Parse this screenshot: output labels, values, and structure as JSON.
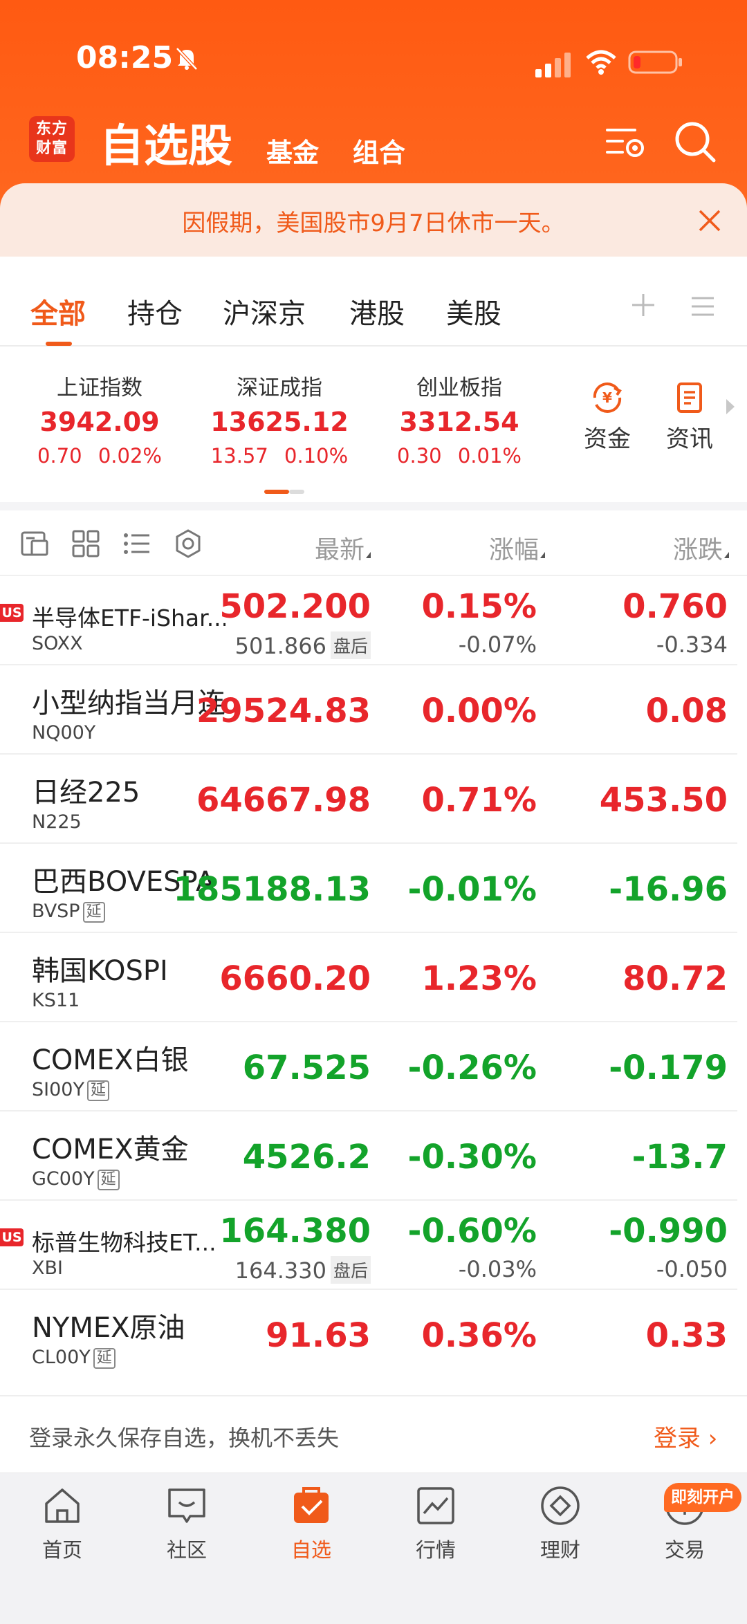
{
  "status_bar": {
    "time": "08:25"
  },
  "header": {
    "logo_line1": "东方",
    "logo_line2": "财富",
    "title": "自选股",
    "tab_fund": "基金",
    "tab_combo": "组合"
  },
  "notice": {
    "text": "因假期，美国股市9月7日休市一天。"
  },
  "tabs": [
    "全部",
    "持仓",
    "沪深京",
    "港股",
    "美股"
  ],
  "indices": [
    {
      "name": "上证指数",
      "value": "3942.09",
      "change": "0.70",
      "pct": "0.02%"
    },
    {
      "name": "深证成指",
      "value": "13625.12",
      "change": "13.57",
      "pct": "0.10%"
    },
    {
      "name": "创业板指",
      "value": "3312.54",
      "change": "0.30",
      "pct": "0.01%"
    }
  ],
  "quick_links": {
    "funds": "资金",
    "news": "资讯"
  },
  "list_header": {
    "latest": "最新",
    "pct": "涨幅",
    "change": "涨跌"
  },
  "rows": [
    {
      "tag": "US",
      "name": "半导体ETF-iShar...",
      "code": "SOXX",
      "price": "502.200",
      "pct": "0.15%",
      "change": "0.760",
      "trend": "up",
      "sub_price": "501.866",
      "sub_tag": "盘后",
      "sub_pct": "-0.07%",
      "sub_change": "-0.334"
    },
    {
      "name": "小型纳指当月连续",
      "code": "NQ00Y",
      "price": "29524.83",
      "pct": "0.00%",
      "change": "0.08",
      "trend": "up"
    },
    {
      "name": "日经225",
      "code": "N225",
      "price": "64667.98",
      "pct": "0.71%",
      "change": "453.50",
      "trend": "up"
    },
    {
      "name": "巴西BOVESPA",
      "code": "BVSP",
      "delay": "延",
      "price": "185188.13",
      "pct": "-0.01%",
      "change": "-16.96",
      "trend": "down"
    },
    {
      "name": "韩国KOSPI",
      "code": "KS11",
      "price": "6660.20",
      "pct": "1.23%",
      "change": "80.72",
      "trend": "up"
    },
    {
      "name": "COMEX白银",
      "code": "SI00Y",
      "delay": "延",
      "price": "67.525",
      "pct": "-0.26%",
      "change": "-0.179",
      "trend": "down"
    },
    {
      "name": "COMEX黄金",
      "code": "GC00Y",
      "delay": "延",
      "price": "4526.2",
      "pct": "-0.30%",
      "change": "-13.7",
      "trend": "down"
    },
    {
      "tag": "US",
      "name": "标普生物科技ET...",
      "code": "XBI",
      "price": "164.380",
      "pct": "-0.60%",
      "change": "-0.990",
      "trend": "down",
      "sub_price": "164.330",
      "sub_tag": "盘后",
      "sub_pct": "-0.03%",
      "sub_change": "-0.050"
    },
    {
      "name": "NYMEX原油",
      "code": "CL00Y",
      "delay": "延",
      "price": "91.63",
      "pct": "0.36%",
      "change": "0.33",
      "trend": "up"
    }
  ],
  "login_bar": {
    "text": "登录永久保存自选，换机不丢失",
    "link": "登录"
  },
  "nav": {
    "home": "首页",
    "community": "社区",
    "watchlist": "自选",
    "market": "行情",
    "wealth": "理财",
    "trade": "交易",
    "open_badge": "即刻开户"
  },
  "colors": {
    "brand": "#ff5a12",
    "up": "#e8262b",
    "down": "#13a32a"
  }
}
